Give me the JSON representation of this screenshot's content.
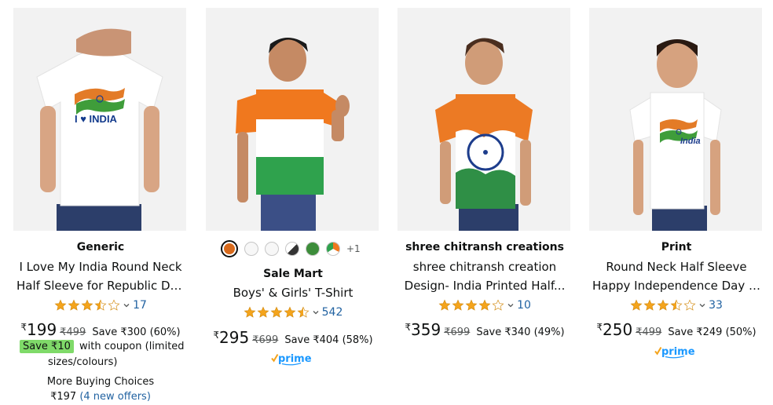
{
  "colors": {
    "link": "#2162a1",
    "star": "#f4a41c",
    "coupon_badge": "#7fda69",
    "prime_blue": "#1a98ff"
  },
  "products": [
    {
      "brand": "Generic",
      "title_line1": "I Love My India Round Neck",
      "title_line2": "Half Sleeve for Republic Day,...",
      "rating": 3.5,
      "rating_count": "17",
      "currency": "₹",
      "price": "199",
      "mrp": "₹499",
      "save": "Save ₹300 (60%)",
      "coupon_badge": "Save ₹10",
      "coupon_text": "with coupon (limited",
      "coupon_text2": "sizes/colours)",
      "more_buying": "More Buying Choices",
      "offer_price": "₹197",
      "offer_link": "(4 new offers)"
    },
    {
      "brand": "Sale Mart",
      "title_line1": "Boys' & Girls' T-Shirt",
      "rating": 4.5,
      "rating_count": "542",
      "currency": "₹",
      "price": "295",
      "mrp": "₹699",
      "save": "Save ₹404 (58%)",
      "prime": "prime",
      "swatch_more": "+1"
    },
    {
      "brand": "shree chitransh creations",
      "title_line1": "shree chitransh creation",
      "title_line2": "Design- India Printed Half...",
      "rating": 4,
      "rating_count": "10",
      "currency": "₹",
      "price": "359",
      "mrp": "₹699",
      "save": "Save ₹340 (49%)"
    },
    {
      "brand": "Print",
      "title_line1": "Round Neck Half Sleeve",
      "title_line2": "Happy Independence Day an...",
      "rating": 3.5,
      "rating_count": "33",
      "currency": "₹",
      "price": "250",
      "mrp": "₹499",
      "save": "Save ₹249 (50%)",
      "prime": "prime"
    }
  ],
  "tshirt_print": {
    "card1": "I ♥ INDIA",
    "card4": "India"
  }
}
